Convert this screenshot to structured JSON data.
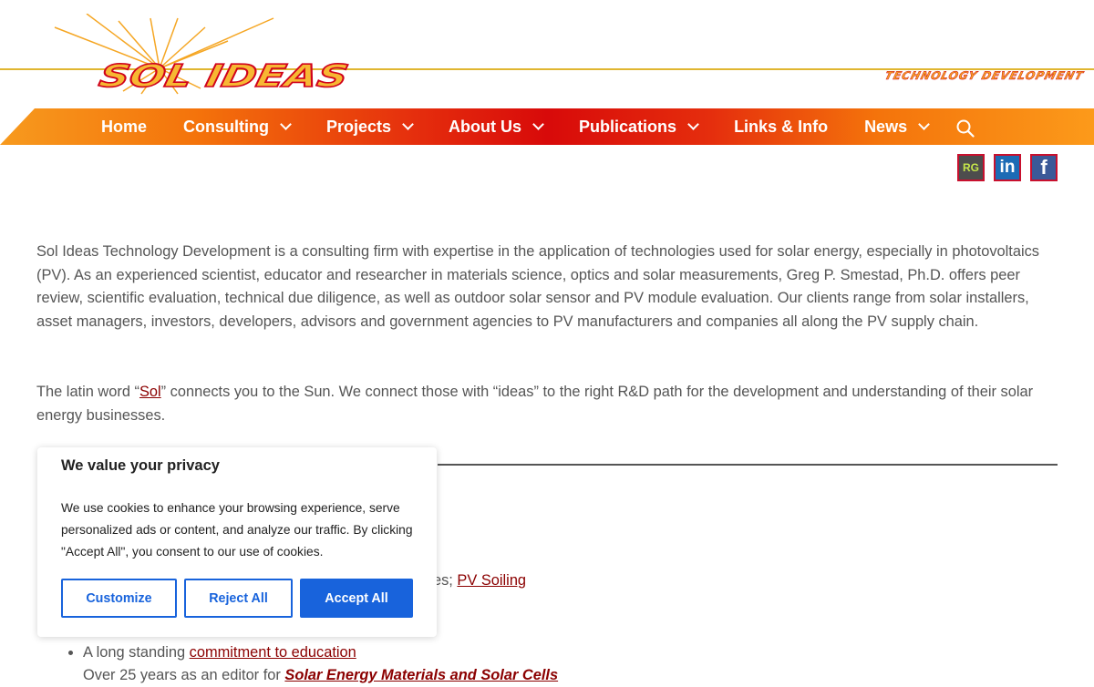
{
  "header": {
    "logo_text": "SOL IDEAS",
    "tagline": "TECHNOLOGY DEVELOPMENT"
  },
  "nav": {
    "items": [
      {
        "label": "Home",
        "has_dropdown": false
      },
      {
        "label": "Consulting",
        "has_dropdown": true
      },
      {
        "label": "Projects",
        "has_dropdown": true
      },
      {
        "label": "About Us",
        "has_dropdown": true
      },
      {
        "label": "Publications",
        "has_dropdown": true
      },
      {
        "label": "Links & Info",
        "has_dropdown": false
      },
      {
        "label": "News",
        "has_dropdown": true
      }
    ],
    "search_icon": "search-icon"
  },
  "social": {
    "researchgate": "RG",
    "linkedin": "in",
    "facebook": "f"
  },
  "content": {
    "intro": "Sol Ideas Technology Development is a consulting firm with expertise in the application of technologies used for solar energy, especially in photovoltaics (PV). As an experienced scientist, educator and researcher in materials science, optics and solar measurements, Greg P. Smestad, Ph.D. offers peer review, scientific evaluation, technical due diligence, as well as outdoor solar sensor and PV module evaluation. Our clients range from solar installers, asset managers, investors, developers, advisors and government agencies to PV manufacturers and companies all along the PV supply chain.",
    "latin_before": "The latin word “",
    "latin_link": "Sol",
    "latin_after": "” connects you to the Sun. We connect those with “ideas” to the right R&D path for the development and understanding of their solar energy businesses.",
    "soiling_prefix": "es; ",
    "soiling_link": "PV Soiling",
    "bullet1_prefix": "A long standing ",
    "bullet1_link": "commitment to education",
    "bullet2_prefix": "Over 25 years as an editor for ",
    "bullet2_link": "Solar Energy Materials and Solar Cells"
  },
  "cookie_banner": {
    "title": "We value your privacy",
    "message": "We use cookies to enhance your browsing experience, serve personalized ads or content, and analyze our traffic. By clicking \"Accept All\", you consent to our use of cookies.",
    "customize_label": "Customize",
    "reject_label": "Reject All",
    "accept_label": "Accept All"
  },
  "colors": {
    "nav_orange": "#f4730b",
    "nav_red": "#d80a0a",
    "link": "#8b0000",
    "cookie_blue": "#1863dc"
  }
}
